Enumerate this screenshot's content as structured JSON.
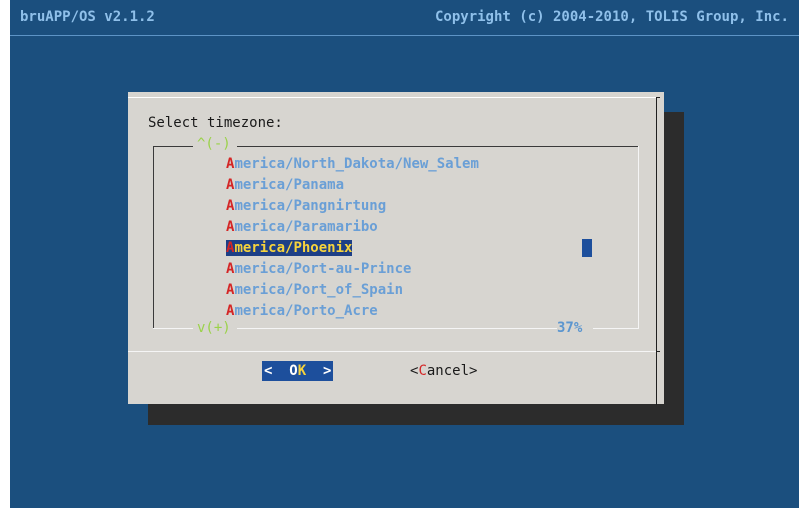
{
  "header": {
    "app_title": "bruAPP/OS v2.1.2",
    "copyright": "Copyright (c) 2004-2010, TOLIS Group, Inc."
  },
  "dialog": {
    "prompt": "Select timezone:",
    "scroll_up": "^(-)",
    "scroll_down": "v(+)",
    "scroll_percent": "37%",
    "items": [
      {
        "first": "A",
        "rest": "merica/North_Dakota/New_Salem",
        "selected": false
      },
      {
        "first": "A",
        "rest": "merica/Panama",
        "selected": false
      },
      {
        "first": "A",
        "rest": "merica/Pangnirtung",
        "selected": false
      },
      {
        "first": "A",
        "rest": "merica/Paramaribo",
        "selected": false
      },
      {
        "first": "A",
        "rest": "merica/Phoenix",
        "selected": true
      },
      {
        "first": "A",
        "rest": "merica/Port-au-Prince",
        "selected": false
      },
      {
        "first": "A",
        "rest": "merica/Port_of_Spain",
        "selected": false
      },
      {
        "first": "A",
        "rest": "merica/Porto_Acre",
        "selected": false
      }
    ],
    "ok_button": {
      "pre": "<  O",
      "hl": "K",
      "post": "  >"
    },
    "cancel_button": {
      "pre": "<",
      "hl": "C",
      "post": "ancel>"
    }
  },
  "colors": {
    "background": "#1b4f7e",
    "dialog": "#d7d5d0",
    "selection": "#1d3f86",
    "hotkey": "#d42525"
  }
}
